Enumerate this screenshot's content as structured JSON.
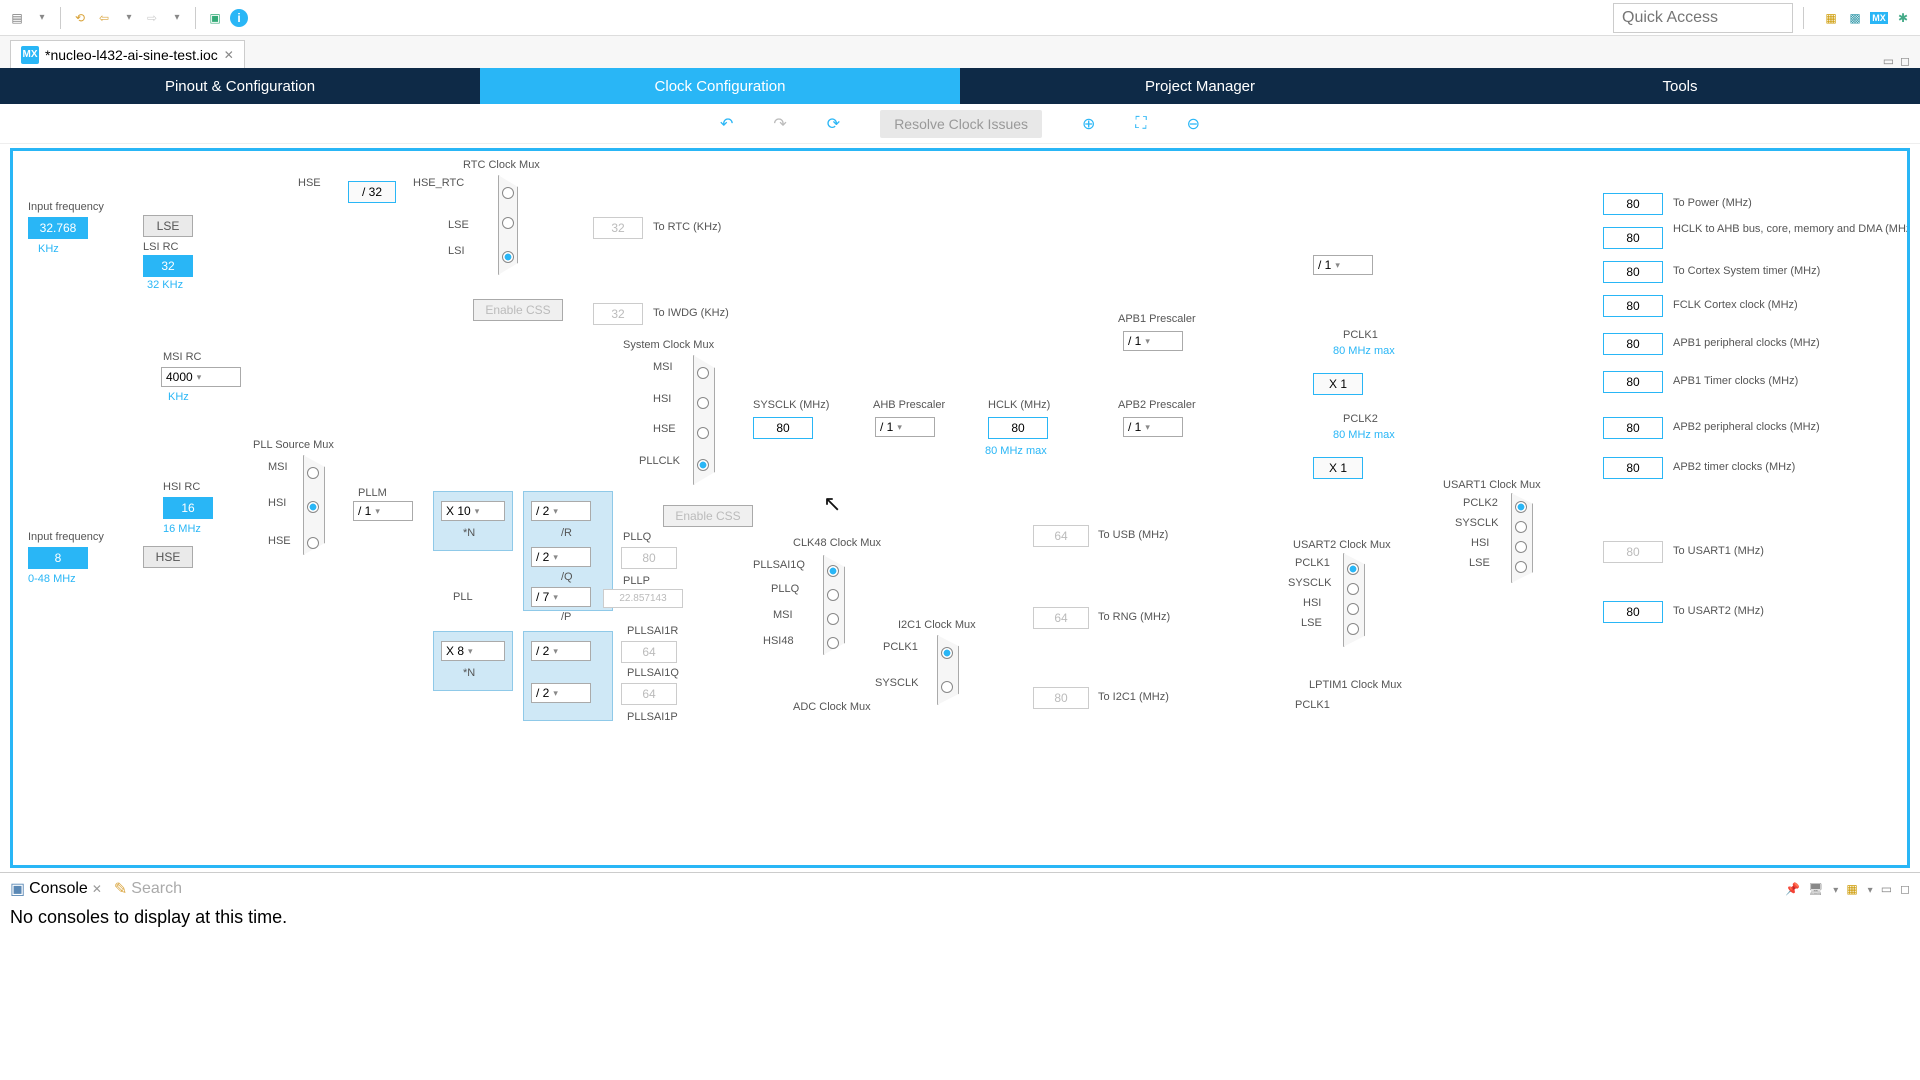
{
  "toolbar": {
    "quick_access": "Quick Access"
  },
  "editor": {
    "tab_title": "*nucleo-l432-ai-sine-test.ioc"
  },
  "main_tabs": [
    "Pinout & Configuration",
    "Clock Configuration",
    "Project Manager",
    "Tools"
  ],
  "sub_toolbar": {
    "resolve": "Resolve Clock Issues"
  },
  "clock": {
    "input_freq_label": "Input frequency",
    "lse_val": "32.768",
    "lse_unit": "KHz",
    "lse_btn": "LSE",
    "lsi_label": "LSI RC",
    "lsi_val": "32",
    "lsi_unit": "32 KHz",
    "rtc_mux": "RTC Clock Mux",
    "hse_lbl": "HSE",
    "hse_div": "/ 32",
    "hse_rtc": "HSE_RTC",
    "lse_lbl": "LSE",
    "lsi_lbl": "LSI",
    "enable_css_rtc": "Enable CSS",
    "to_rtc": "To RTC (KHz)",
    "to_rtc_val": "32",
    "to_iwdg": "To IWDG (KHz)",
    "to_iwdg_val": "32",
    "msi_rc": "MSI RC",
    "msi_val": "4000",
    "msi_unit": "KHz",
    "hsi_rc": "HSI RC",
    "hsi_val": "16",
    "hsi_unit": "16 MHz",
    "hse_input_label": "Input frequency",
    "hse_val": "8",
    "hse_range": "0-48 MHz",
    "hse_btn": "HSE",
    "pll_src_mux": "PLL Source Mux",
    "pll_msi": "MSI",
    "pll_hsi": "HSI",
    "pll_hse": "HSE",
    "pllm": "PLLM",
    "pllm_val": "/ 1",
    "plln": "X 10",
    "plln_lbl": "*N",
    "pllr": "/ 2",
    "pllr_lbl": "/R",
    "pllq_div": "/ 2",
    "pllq_lbl2": "/Q",
    "pllp_div": "/ 7",
    "pllp_lbl2": "/P",
    "pll_lbl": "PLL",
    "pllq": "PLLQ",
    "pllq_val": "80",
    "pllp": "PLLP",
    "pllp_val": "22.857143",
    "pllsai1r": "PLLSAI1R",
    "pllsai1r_mul": "X 8",
    "pllsai1r_div": "/ 2",
    "pllsai1r_val": "64",
    "pllsai1q": "PLLSAI1Q",
    "pllsai1q_div": "/ 2",
    "pllsai1q_val": "64",
    "pllsai1p": "PLLSAI1P",
    "sys_mux": "System Clock Mux",
    "sys_msi": "MSI",
    "sys_hsi": "HSI",
    "sys_hse": "HSE",
    "sys_pllclk": "PLLCLK",
    "enable_css_sys": "Enable CSS",
    "sysclk_lbl": "SYSCLK (MHz)",
    "sysclk_val": "80",
    "ahb_pre": "AHB Prescaler",
    "ahb_val": "/ 1",
    "hclk_lbl": "HCLK (MHz)",
    "hclk_val": "80",
    "hclk_max": "80 MHz max",
    "cortex_div": "/ 1",
    "apb1_pre": "APB1 Prescaler",
    "apb1_val": "/ 1",
    "pclk1": "PCLK1",
    "pclk1_max": "80 MHz max",
    "apb1_tim": "X 1",
    "apb2_pre": "APB2 Prescaler",
    "apb2_val": "/ 1",
    "pclk2": "PCLK2",
    "pclk2_max": "80 MHz max",
    "apb2_tim": "X 1",
    "outputs": {
      "power": {
        "val": "80",
        "lbl": "To Power (MHz)"
      },
      "ahb_bus": {
        "val": "80",
        "lbl": "HCLK to AHB bus, core, memory and DMA (MHz)"
      },
      "cortex_timer": {
        "val": "80",
        "lbl": "To Cortex System timer (MHz)"
      },
      "fclk": {
        "val": "80",
        "lbl": "FCLK Cortex clock (MHz)"
      },
      "apb1_periph": {
        "val": "80",
        "lbl": "APB1 peripheral clocks (MHz)"
      },
      "apb1_timer": {
        "val": "80",
        "lbl": "APB1 Timer clocks (MHz)"
      },
      "apb2_periph": {
        "val": "80",
        "lbl": "APB2 peripheral clocks (MHz)"
      },
      "apb2_timer": {
        "val": "80",
        "lbl": "APB2 timer clocks (MHz)"
      },
      "usart1": {
        "val": "80",
        "lbl": "To USART1 (MHz)"
      },
      "usart2": {
        "val": "80",
        "lbl": "To USART2 (MHz)"
      }
    },
    "clk48_mux": "CLK48 Clock Mux",
    "clk48_pllsai1q": "PLLSAI1Q",
    "clk48_pllq": "PLLQ",
    "clk48_msi": "MSI",
    "clk48_hsi48": "HSI48",
    "to_usb": "To USB (MHz)",
    "to_usb_val": "64",
    "to_rng": "To RNG (MHz)",
    "to_rng_val": "64",
    "i2c1_mux": "I2C1 Clock Mux",
    "i2c1_pclk1": "PCLK1",
    "i2c1_sysclk": "SYSCLK",
    "to_i2c1": "To I2C1 (MHz)",
    "to_i2c1_val": "80",
    "adc_mux": "ADC Clock Mux",
    "usart1_mux": "USART1 Clock Mux",
    "u1_pclk2": "PCLK2",
    "u1_sysclk": "SYSCLK",
    "u1_hsi": "HSI",
    "u1_lse": "LSE",
    "usart2_mux": "USART2 Clock Mux",
    "u2_pclk1": "PCLK1",
    "u2_sysclk": "SYSCLK",
    "u2_hsi": "HSI",
    "u2_lse": "LSE",
    "lptim1_mux": "LPTIM1 Clock Mux",
    "lptim1_pclk1": "PCLK1"
  },
  "console": {
    "tab": "Console",
    "search_tab": "Search",
    "msg": "No consoles to display at this time."
  }
}
